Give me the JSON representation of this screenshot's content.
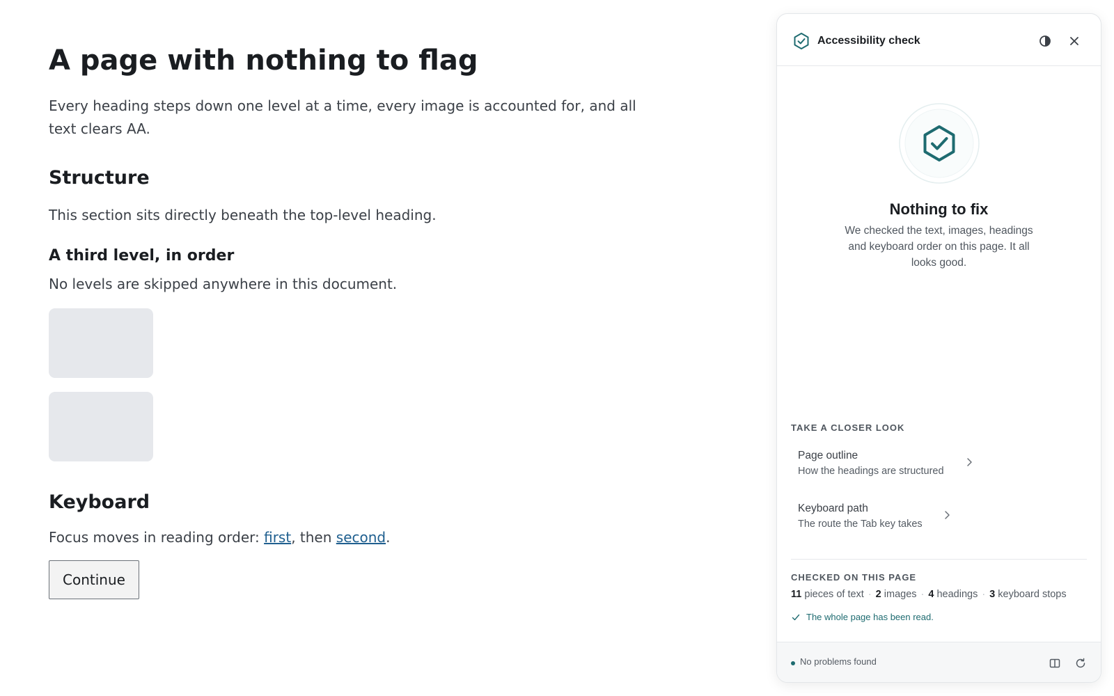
{
  "page": {
    "title": "A page with nothing to flag",
    "intro": "Every heading steps down one level at a time, every image is accounted for, and all text clears AA.",
    "sections": {
      "structure": {
        "heading": "Structure",
        "text": "This section sits directly beneath the top-level heading."
      },
      "third": {
        "heading": "A third level, in order",
        "text": "No levels are skipped anywhere in this document."
      },
      "keyboard": {
        "heading": "Keyboard",
        "text_before": "Focus moves in reading order: ",
        "link_first": "first",
        "text_middle": ", then ",
        "link_second": "second",
        "text_after": "."
      }
    },
    "continue_label": "Continue"
  },
  "panel": {
    "title": "Accessibility check",
    "icons": {
      "logo": "shield-check-icon",
      "contrast": "contrast-icon",
      "close": "close-icon",
      "badge": "shield-check-icon",
      "chevron": "chevron-right-icon",
      "check": "check-icon",
      "layout": "side-panel-icon",
      "refresh": "refresh-icon"
    },
    "status": "Nothing to fix",
    "description": "We checked the text, images, headings and keyboard order on this page. It all looks good.",
    "closer_look": {
      "label": "TAKE A CLOSER LOOK",
      "items": [
        {
          "title": "Page outline",
          "subtitle": "How the headings are structured"
        },
        {
          "title": "Keyboard path",
          "subtitle": "The route the Tab key takes"
        }
      ]
    },
    "checked": {
      "label": "CHECKED ON THIS PAGE",
      "stats": [
        {
          "count": "11",
          "label": "pieces of text"
        },
        {
          "count": "2",
          "label": "images"
        },
        {
          "count": "4",
          "label": "headings"
        },
        {
          "count": "3",
          "label": "keyboard stops"
        }
      ],
      "note": "The whole page has been read."
    },
    "footer": {
      "status": "No problems found"
    }
  },
  "colors": {
    "accent": "#1e6b70",
    "link": "#1f5f8f",
    "placeholder": "#e6e8ec",
    "success_dot": "#1e6b70"
  }
}
